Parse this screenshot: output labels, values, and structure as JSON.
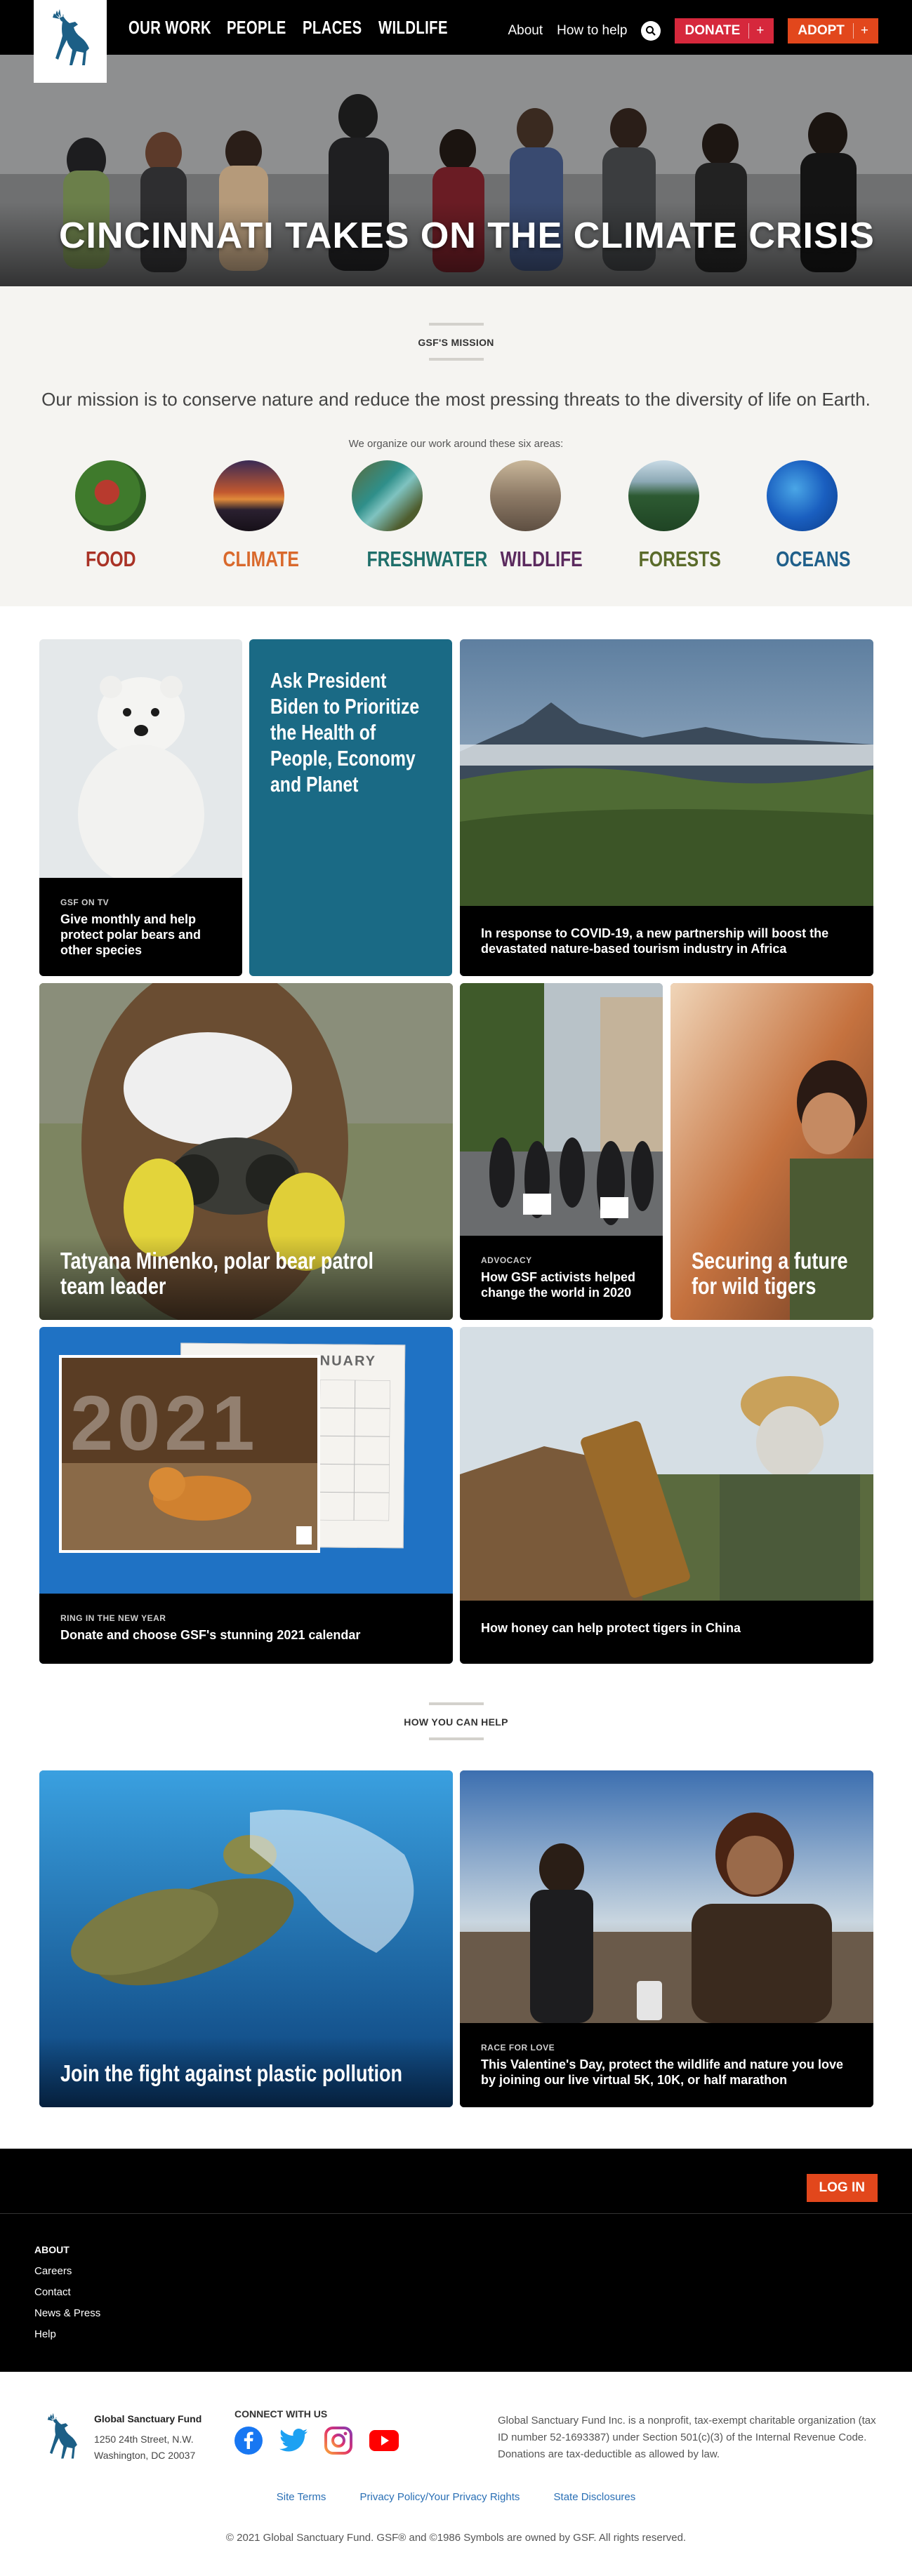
{
  "nav": {
    "main": [
      "OUR WORK",
      "PEOPLE",
      "PLACES",
      "WILDLIFE"
    ],
    "about": "About",
    "how_to_help": "How to help",
    "donate": "DONATE",
    "adopt": "ADOPT",
    "plus": "+"
  },
  "hero": {
    "title": "CINCINNATI TAKES ON THE CLIMATE CRISIS"
  },
  "mission": {
    "heading": "GSF'S MISSION",
    "text": "Our mission is to conserve nature and reduce the most pressing threats to the diversity of life on Earth.",
    "subtext": "We organize our work around these six areas:",
    "areas": [
      {
        "name": "FOOD",
        "color": "#a93226"
      },
      {
        "name": "CLIMATE",
        "color": "#d9692c"
      },
      {
        "name": "FRESHWATER",
        "color": "#1f6f6a"
      },
      {
        "name": "WILDLIFE",
        "color": "#5b2a5e"
      },
      {
        "name": "FORESTS",
        "color": "#5a6b2a"
      },
      {
        "name": "OCEANS",
        "color": "#1f5f8a"
      }
    ]
  },
  "cards": {
    "polar": {
      "tag": "GSF ON TV",
      "title": "Give monthly and help protect polar bears and other species"
    },
    "biden": {
      "title": "Ask President Biden to Prioritize the Health of People, Economy and Planet"
    },
    "africa": {
      "title": "In response to COVID-19, a new partnership will boost the devastated nature-based tourism industry in Africa"
    },
    "tatyana": {
      "title": "Tatyana Minenko, polar bear patrol team leader"
    },
    "advocacy": {
      "tag": "ADVOCACY",
      "title": "How GSF activists helped change the world in 2020"
    },
    "tigers": {
      "title": "Securing a future for wild tigers"
    },
    "calendar": {
      "tag": "RING IN THE NEW YEAR",
      "title": "Donate and choose GSF's stunning 2021 calendar",
      "month": "JANUARY",
      "year": "2021"
    },
    "honey": {
      "title": "How honey can help protect tigers in China"
    }
  },
  "help": {
    "heading": "HOW YOU CAN HELP",
    "plastic": {
      "title": "Join the fight against plastic pollution"
    },
    "race": {
      "tag": "RACE FOR LOVE",
      "title": "This Valentine's Day, protect the wildlife and nature you love by joining our live virtual 5K, 10K, or half marathon"
    }
  },
  "footer": {
    "login": "LOG IN",
    "about_heading": "ABOUT",
    "about_items": [
      "Careers",
      "Contact",
      "News & Press",
      "Help"
    ],
    "org_name": "Global Sanctuary Fund",
    "address1": "1250 24th Street, N.W.",
    "address2": "Washington, DC 20037",
    "connect": "CONNECT WITH US",
    "social_icons": [
      "facebook-icon",
      "twitter-icon",
      "instagram-icon",
      "youtube-icon"
    ],
    "legal": "Global Sanctuary Fund Inc. is a nonprofit, tax-exempt charitable organization (tax ID number 52-1693387) under Section 501(c)(3) of the Internal Revenue Code. Donations are tax-deductible as allowed by law.",
    "links": [
      "Site Terms",
      "Privacy Policy/Your Privacy Rights",
      "State Disclosures"
    ],
    "copyright": "© 2021 Global Sanctuary Fund. GSF® and ©1986 Symbols are owned by GSF. All rights reserved."
  },
  "colors": {
    "accent": "#e2471c",
    "teal_card": "#1a6a85",
    "calendar_blue": "#1f72c4",
    "nav_bg": "#000000"
  }
}
